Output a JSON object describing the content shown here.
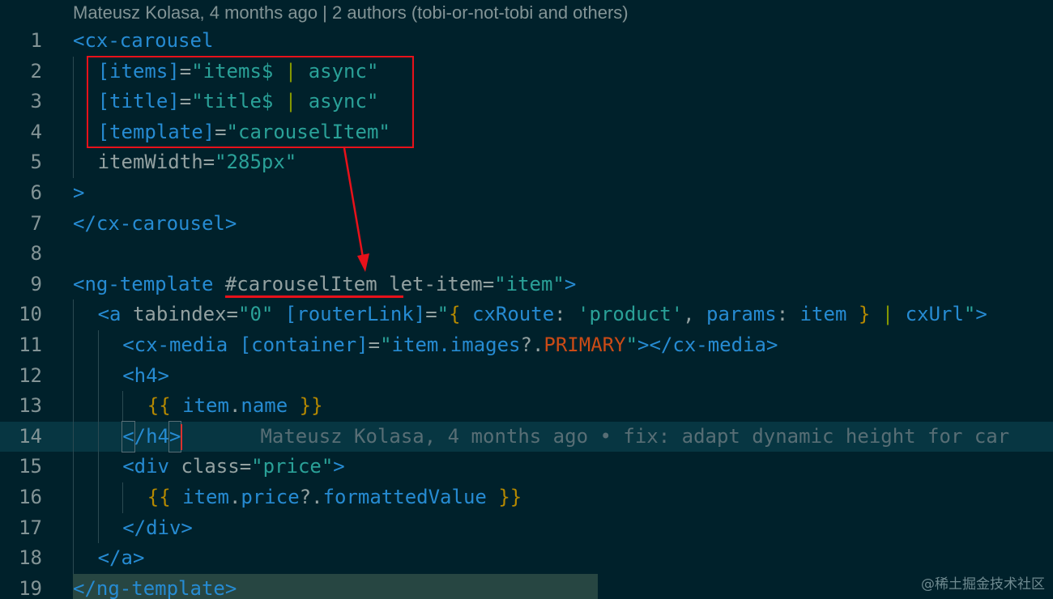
{
  "codelens": "Mateusz Kolasa, 4 months ago | 2 authors (tobi-or-not-tobi and others)",
  "lines": [
    {
      "n": "1",
      "indent": 0,
      "tokens": [
        {
          "c": "t-tag",
          "t": "<cx-carousel"
        }
      ]
    },
    {
      "n": "2",
      "indent": 1,
      "tokens": [
        {
          "c": "t-bind",
          "t": "[items]"
        },
        {
          "c": "t-plain",
          "t": "="
        },
        {
          "c": "t-str",
          "t": "\"items$ "
        },
        {
          "c": "t-pipe",
          "t": "|"
        },
        {
          "c": "t-str",
          "t": " async\""
        }
      ]
    },
    {
      "n": "3",
      "indent": 1,
      "tokens": [
        {
          "c": "t-bind",
          "t": "[title]"
        },
        {
          "c": "t-plain",
          "t": "="
        },
        {
          "c": "t-str",
          "t": "\"title$ "
        },
        {
          "c": "t-pipe",
          "t": "|"
        },
        {
          "c": "t-str",
          "t": " async\""
        }
      ]
    },
    {
      "n": "4",
      "indent": 1,
      "tokens": [
        {
          "c": "t-bind",
          "t": "[template]"
        },
        {
          "c": "t-plain",
          "t": "="
        },
        {
          "c": "t-str",
          "t": "\"carouselItem\""
        }
      ]
    },
    {
      "n": "5",
      "indent": 1,
      "tokens": [
        {
          "c": "t-attr",
          "t": "itemWidth"
        },
        {
          "c": "t-plain",
          "t": "="
        },
        {
          "c": "t-str",
          "t": "\"285px\""
        }
      ]
    },
    {
      "n": "6",
      "indent": 0,
      "tokens": [
        {
          "c": "t-tag",
          "t": ">"
        }
      ]
    },
    {
      "n": "7",
      "indent": 0,
      "tokens": [
        {
          "c": "t-tag",
          "t": "</cx-carousel>"
        }
      ]
    },
    {
      "n": "8",
      "indent": 0,
      "tokens": []
    },
    {
      "n": "9",
      "indent": 0,
      "tokens": [
        {
          "c": "t-tag",
          "t": "<ng-template "
        },
        {
          "c": "t-attr",
          "t": "#carouselItem let-item"
        },
        {
          "c": "t-plain",
          "t": "="
        },
        {
          "c": "t-str",
          "t": "\"item\""
        },
        {
          "c": "t-tag",
          "t": ">"
        }
      ]
    },
    {
      "n": "10",
      "indent": 1,
      "tokens": [
        {
          "c": "t-tag",
          "t": "<a "
        },
        {
          "c": "t-attr",
          "t": "tabindex"
        },
        {
          "c": "t-plain",
          "t": "="
        },
        {
          "c": "t-str",
          "t": "\"0\" "
        },
        {
          "c": "t-bind",
          "t": "[routerLink]"
        },
        {
          "c": "t-plain",
          "t": "="
        },
        {
          "c": "t-str",
          "t": "\""
        },
        {
          "c": "t-brace",
          "t": "{"
        },
        {
          "c": "t-bind",
          "t": " cxRoute"
        },
        {
          "c": "t-plain",
          "t": ": "
        },
        {
          "c": "t-str",
          "t": "'product'"
        },
        {
          "c": "t-plain",
          "t": ", "
        },
        {
          "c": "t-bind",
          "t": "params"
        },
        {
          "c": "t-plain",
          "t": ": "
        },
        {
          "c": "t-bind",
          "t": "item "
        },
        {
          "c": "t-brace",
          "t": "}"
        },
        {
          "c": "t-pipe",
          "t": " | "
        },
        {
          "c": "t-bind",
          "t": "cxUrl"
        },
        {
          "c": "t-str",
          "t": "\""
        },
        {
          "c": "t-tag",
          "t": ">"
        }
      ]
    },
    {
      "n": "11",
      "indent": 2,
      "tokens": [
        {
          "c": "t-tag",
          "t": "<cx-media "
        },
        {
          "c": "t-bind",
          "t": "[container]"
        },
        {
          "c": "t-plain",
          "t": "="
        },
        {
          "c": "t-str",
          "t": "\""
        },
        {
          "c": "t-bind",
          "t": "item.images"
        },
        {
          "c": "t-plain",
          "t": "?."
        },
        {
          "c": "t-orange",
          "t": "PRIMARY"
        },
        {
          "c": "t-str",
          "t": "\""
        },
        {
          "c": "t-tag",
          "t": "></cx-media>"
        }
      ]
    },
    {
      "n": "12",
      "indent": 2,
      "tokens": [
        {
          "c": "t-tag",
          "t": "<h4>"
        }
      ]
    },
    {
      "n": "13",
      "indent": 3,
      "tokens": [
        {
          "c": "t-brace",
          "t": "{{"
        },
        {
          "c": "t-bind",
          "t": " item"
        },
        {
          "c": "t-plain",
          "t": "."
        },
        {
          "c": "t-bind",
          "t": "name "
        },
        {
          "c": "t-brace",
          "t": "}}"
        }
      ]
    },
    {
      "n": "14",
      "indent": 2,
      "current": true,
      "tokens": [
        {
          "c": "t-tag caret-box",
          "t": "<"
        },
        {
          "c": "t-tag",
          "t": "/h4"
        },
        {
          "c": "t-tag caret-box",
          "t": ">"
        },
        {
          "c": "cursor",
          "t": ""
        },
        {
          "c": "t-blame",
          "t": "Mateusz Kolasa, 4 months ago • fix: adapt dynamic height for car"
        }
      ]
    },
    {
      "n": "15",
      "indent": 2,
      "tokens": [
        {
          "c": "t-tag",
          "t": "<div "
        },
        {
          "c": "t-attr",
          "t": "class"
        },
        {
          "c": "t-plain",
          "t": "="
        },
        {
          "c": "t-str",
          "t": "\"price\""
        },
        {
          "c": "t-tag",
          "t": ">"
        }
      ]
    },
    {
      "n": "16",
      "indent": 3,
      "tokens": [
        {
          "c": "t-brace",
          "t": "{{"
        },
        {
          "c": "t-bind",
          "t": " item"
        },
        {
          "c": "t-plain",
          "t": "."
        },
        {
          "c": "t-bind",
          "t": "price"
        },
        {
          "c": "t-plain",
          "t": "?."
        },
        {
          "c": "t-bind",
          "t": "formattedValue "
        },
        {
          "c": "t-brace",
          "t": "}}"
        }
      ]
    },
    {
      "n": "17",
      "indent": 2,
      "tokens": [
        {
          "c": "t-tag",
          "t": "</div>"
        }
      ]
    },
    {
      "n": "18",
      "indent": 1,
      "tokens": [
        {
          "c": "t-tag",
          "t": "</a>"
        }
      ]
    },
    {
      "n": "19",
      "indent": 0,
      "selected": true,
      "tokens": [
        {
          "c": "t-tag",
          "t": "</ng-template>"
        }
      ]
    }
  ],
  "watermark": "@稀土掘金技术社区",
  "colors": {
    "background": "#00212b",
    "annotation": "#e8111a"
  }
}
